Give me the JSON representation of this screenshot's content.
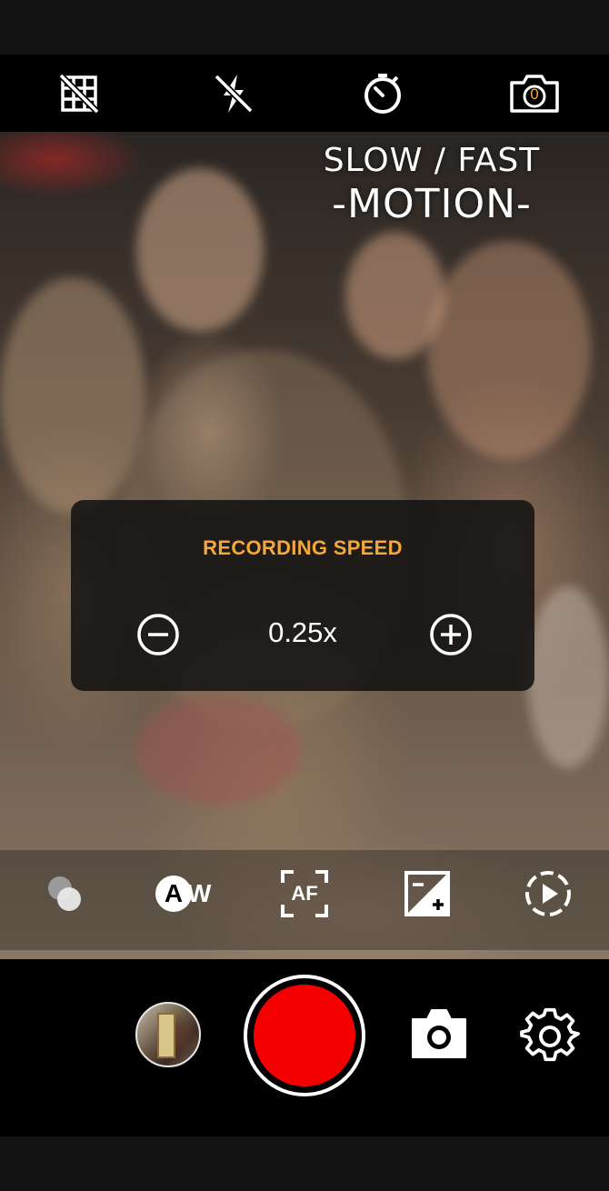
{
  "top_bar": {
    "icons": [
      "grid-off-icon",
      "flash-off-icon",
      "timer-icon",
      "camera-timer-icon"
    ],
    "camera_badge": "0"
  },
  "viewfinder": {
    "promo_line1": "SLOW / FAST",
    "promo_line2": "-MOTION-"
  },
  "speed_panel": {
    "label": "RECORDING SPEED",
    "value": "0.25x",
    "accent_color": "#f3a93a"
  },
  "toolbar": {
    "icons": [
      "color-effects-icon",
      "auto-white-balance-icon",
      "autofocus-icon",
      "exposure-icon",
      "playback-speed-icon"
    ],
    "awb_text": "W",
    "awb_letter": "A",
    "af_text": "AF"
  },
  "bottom_bar": {
    "icons": [
      "gallery-thumbnail",
      "record-button",
      "photo-camera-icon",
      "settings-gear-icon"
    ],
    "record_color": "#f40000"
  }
}
